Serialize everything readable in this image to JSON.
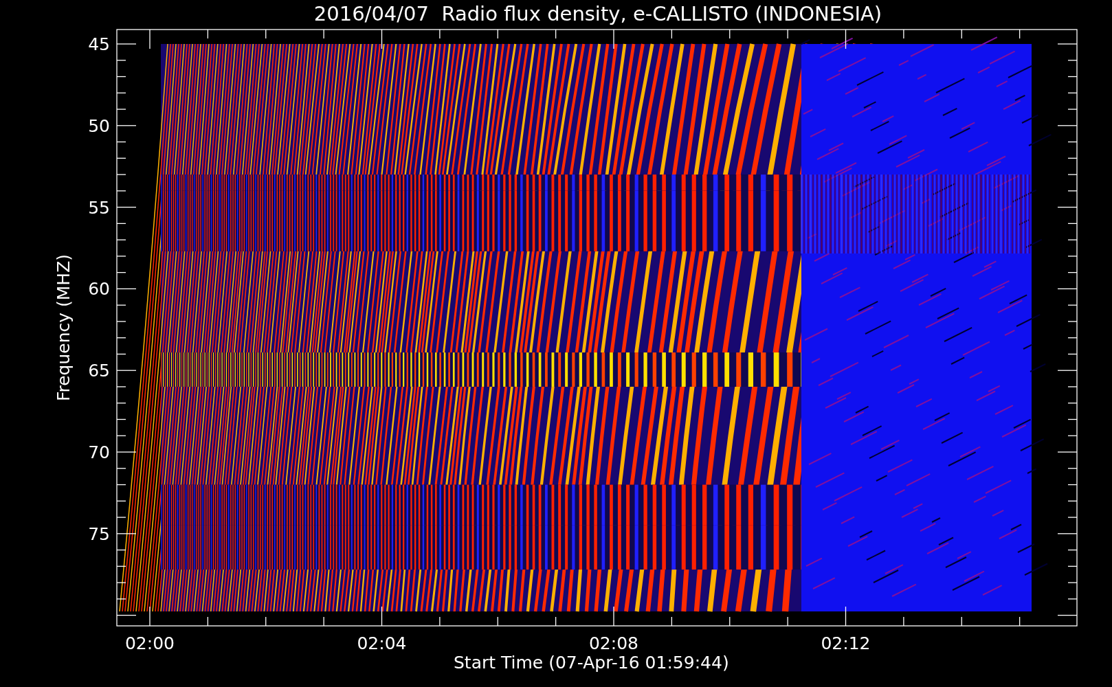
{
  "plot": {
    "title": "2016/04/07  Radio flux density, e-CALLISTO (INDONESIA)",
    "ylabel": "Frequency (MHZ)",
    "xlabel": "Start Time (07-Apr-16 01:59:44)",
    "yticks": [
      "45",
      "50",
      "55",
      "60",
      "65",
      "70",
      "75"
    ],
    "xticks": [
      "02:00",
      "02:04",
      "02:08",
      "02:12"
    ]
  }
}
